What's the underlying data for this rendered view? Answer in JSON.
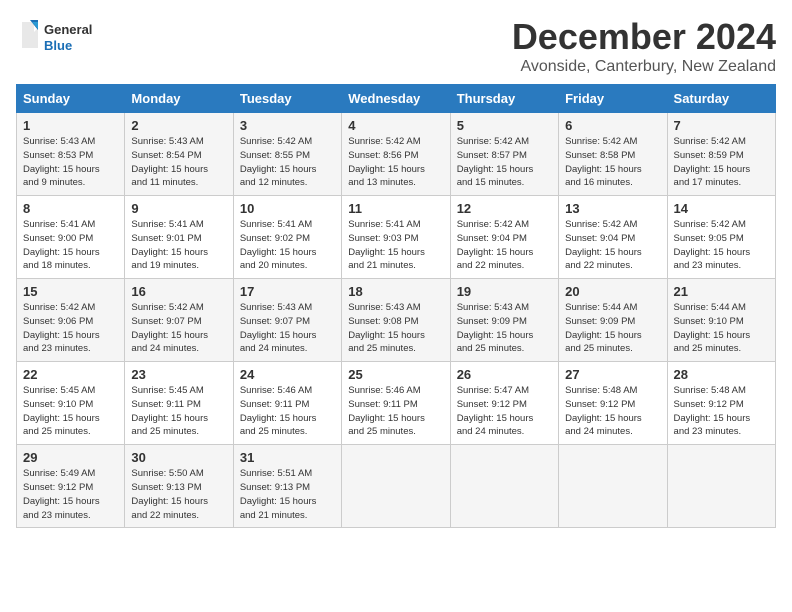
{
  "logo": {
    "text_general": "General",
    "text_blue": "Blue"
  },
  "title": "December 2024",
  "location": "Avonside, Canterbury, New Zealand",
  "calendar": {
    "headers": [
      "Sunday",
      "Monday",
      "Tuesday",
      "Wednesday",
      "Thursday",
      "Friday",
      "Saturday"
    ],
    "weeks": [
      [
        {
          "day": "",
          "info": ""
        },
        {
          "day": "2",
          "info": "Sunrise: 5:43 AM\nSunset: 8:54 PM\nDaylight: 15 hours\nand 11 minutes."
        },
        {
          "day": "3",
          "info": "Sunrise: 5:42 AM\nSunset: 8:55 PM\nDaylight: 15 hours\nand 12 minutes."
        },
        {
          "day": "4",
          "info": "Sunrise: 5:42 AM\nSunset: 8:56 PM\nDaylight: 15 hours\nand 13 minutes."
        },
        {
          "day": "5",
          "info": "Sunrise: 5:42 AM\nSunset: 8:57 PM\nDaylight: 15 hours\nand 15 minutes."
        },
        {
          "day": "6",
          "info": "Sunrise: 5:42 AM\nSunset: 8:58 PM\nDaylight: 15 hours\nand 16 minutes."
        },
        {
          "day": "7",
          "info": "Sunrise: 5:42 AM\nSunset: 8:59 PM\nDaylight: 15 hours\nand 17 minutes."
        }
      ],
      [
        {
          "day": "8",
          "info": "Sunrise: 5:41 AM\nSunset: 9:00 PM\nDaylight: 15 hours\nand 18 minutes."
        },
        {
          "day": "9",
          "info": "Sunrise: 5:41 AM\nSunset: 9:01 PM\nDaylight: 15 hours\nand 19 minutes."
        },
        {
          "day": "10",
          "info": "Sunrise: 5:41 AM\nSunset: 9:02 PM\nDaylight: 15 hours\nand 20 minutes."
        },
        {
          "day": "11",
          "info": "Sunrise: 5:41 AM\nSunset: 9:03 PM\nDaylight: 15 hours\nand 21 minutes."
        },
        {
          "day": "12",
          "info": "Sunrise: 5:42 AM\nSunset: 9:04 PM\nDaylight: 15 hours\nand 22 minutes."
        },
        {
          "day": "13",
          "info": "Sunrise: 5:42 AM\nSunset: 9:04 PM\nDaylight: 15 hours\nand 22 minutes."
        },
        {
          "day": "14",
          "info": "Sunrise: 5:42 AM\nSunset: 9:05 PM\nDaylight: 15 hours\nand 23 minutes."
        }
      ],
      [
        {
          "day": "15",
          "info": "Sunrise: 5:42 AM\nSunset: 9:06 PM\nDaylight: 15 hours\nand 23 minutes."
        },
        {
          "day": "16",
          "info": "Sunrise: 5:42 AM\nSunset: 9:07 PM\nDaylight: 15 hours\nand 24 minutes."
        },
        {
          "day": "17",
          "info": "Sunrise: 5:43 AM\nSunset: 9:07 PM\nDaylight: 15 hours\nand 24 minutes."
        },
        {
          "day": "18",
          "info": "Sunrise: 5:43 AM\nSunset: 9:08 PM\nDaylight: 15 hours\nand 25 minutes."
        },
        {
          "day": "19",
          "info": "Sunrise: 5:43 AM\nSunset: 9:09 PM\nDaylight: 15 hours\nand 25 minutes."
        },
        {
          "day": "20",
          "info": "Sunrise: 5:44 AM\nSunset: 9:09 PM\nDaylight: 15 hours\nand 25 minutes."
        },
        {
          "day": "21",
          "info": "Sunrise: 5:44 AM\nSunset: 9:10 PM\nDaylight: 15 hours\nand 25 minutes."
        }
      ],
      [
        {
          "day": "22",
          "info": "Sunrise: 5:45 AM\nSunset: 9:10 PM\nDaylight: 15 hours\nand 25 minutes."
        },
        {
          "day": "23",
          "info": "Sunrise: 5:45 AM\nSunset: 9:11 PM\nDaylight: 15 hours\nand 25 minutes."
        },
        {
          "day": "24",
          "info": "Sunrise: 5:46 AM\nSunset: 9:11 PM\nDaylight: 15 hours\nand 25 minutes."
        },
        {
          "day": "25",
          "info": "Sunrise: 5:46 AM\nSunset: 9:11 PM\nDaylight: 15 hours\nand 25 minutes."
        },
        {
          "day": "26",
          "info": "Sunrise: 5:47 AM\nSunset: 9:12 PM\nDaylight: 15 hours\nand 24 minutes."
        },
        {
          "day": "27",
          "info": "Sunrise: 5:48 AM\nSunset: 9:12 PM\nDaylight: 15 hours\nand 24 minutes."
        },
        {
          "day": "28",
          "info": "Sunrise: 5:48 AM\nSunset: 9:12 PM\nDaylight: 15 hours\nand 23 minutes."
        }
      ],
      [
        {
          "day": "29",
          "info": "Sunrise: 5:49 AM\nSunset: 9:12 PM\nDaylight: 15 hours\nand 23 minutes."
        },
        {
          "day": "30",
          "info": "Sunrise: 5:50 AM\nSunset: 9:13 PM\nDaylight: 15 hours\nand 22 minutes."
        },
        {
          "day": "31",
          "info": "Sunrise: 5:51 AM\nSunset: 9:13 PM\nDaylight: 15 hours\nand 21 minutes."
        },
        {
          "day": "",
          "info": ""
        },
        {
          "day": "",
          "info": ""
        },
        {
          "day": "",
          "info": ""
        },
        {
          "day": "",
          "info": ""
        }
      ]
    ],
    "week0": {
      "day1": "1",
      "day1_info": "Sunrise: 5:43 AM\nSunset: 8:53 PM\nDaylight: 15 hours\nand 9 minutes."
    }
  }
}
